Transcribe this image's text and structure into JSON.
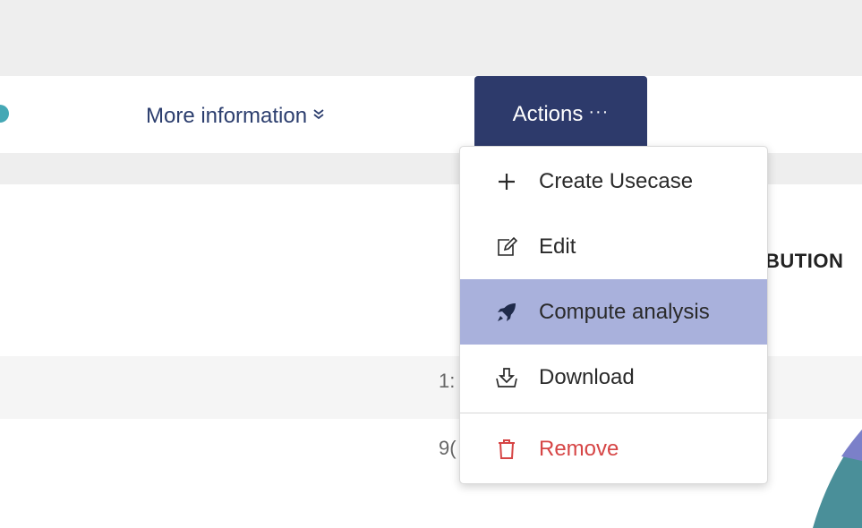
{
  "tabs": {
    "more_info_label": "More information",
    "more_info_icon": "double-chevron-down-icon",
    "actions_label": "Actions",
    "actions_icon": "ellipsis-icon"
  },
  "table": {
    "partial_column_header": "BUTION",
    "partial_cells": [
      "1:",
      "9("
    ]
  },
  "actions_menu": {
    "items": [
      {
        "label": "Create Usecase",
        "icon": "plus-icon"
      },
      {
        "label": "Edit",
        "icon": "edit-icon"
      },
      {
        "label": "Compute analysis",
        "icon": "rocket-icon",
        "highlighted": true
      },
      {
        "label": "Download",
        "icon": "download-icon"
      },
      {
        "label": "Remove",
        "icon": "trash-icon"
      }
    ]
  },
  "colors": {
    "actions_bg": "#2d3a6b",
    "highlight": "#a9b1dc",
    "danger": "#d64545",
    "link": "#2c3e6e",
    "tab_dot": "#45a8b5"
  }
}
